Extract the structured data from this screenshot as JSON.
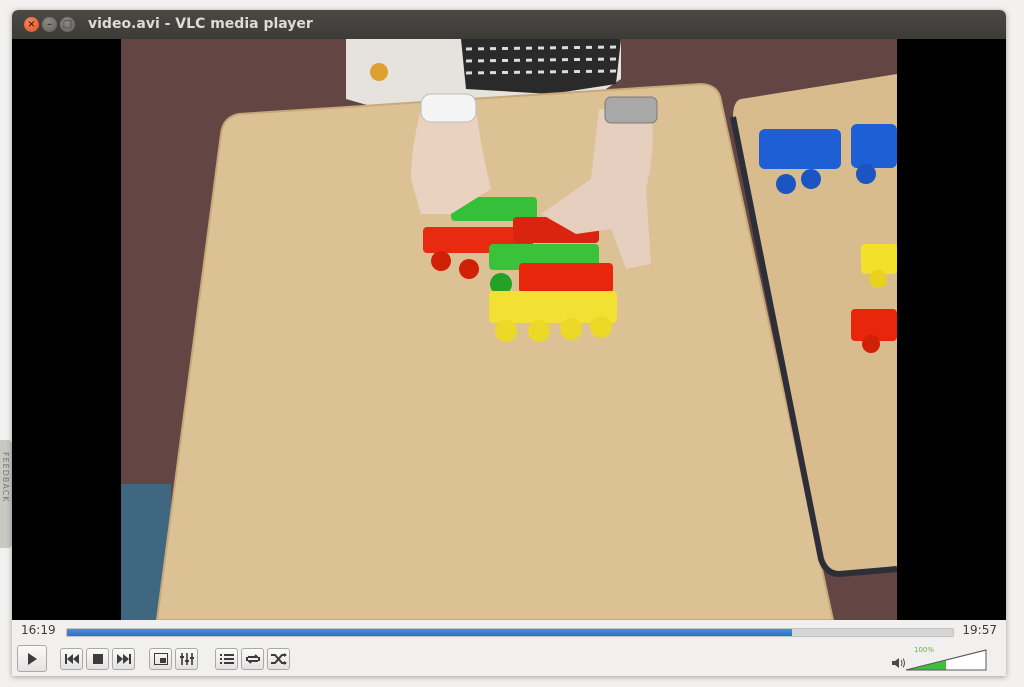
{
  "window": {
    "title": "video.avi - VLC media player"
  },
  "side_tab": {
    "label": "FEEDBACK"
  },
  "playback": {
    "elapsed": "16:19",
    "total": "19:57",
    "progress_fraction": 0.8178
  },
  "controls": {
    "buttons": [
      {
        "name": "play-button",
        "icon": "play-icon"
      },
      {
        "name": "previous-button",
        "icon": "skip-back-icon"
      },
      {
        "name": "stop-button",
        "icon": "stop-icon"
      },
      {
        "name": "next-button",
        "icon": "skip-forward-icon"
      },
      {
        "name": "fullscreen-button",
        "icon": "fullscreen-icon"
      },
      {
        "name": "extended-settings-button",
        "icon": "equalizer-icon"
      },
      {
        "name": "playlist-button",
        "icon": "playlist-icon"
      },
      {
        "name": "loop-button",
        "icon": "loop-icon"
      },
      {
        "name": "shuffle-button",
        "icon": "shuffle-icon"
      }
    ]
  },
  "volume": {
    "label": "100%",
    "level_fraction": 0.5,
    "icon": "speaker-icon",
    "color": "#3fbf3f"
  },
  "colors": {
    "title_bar": "#3c3b37",
    "close_button": "#df4a16",
    "seek_fill": "#2e6fc4",
    "table": "#dcc195"
  }
}
